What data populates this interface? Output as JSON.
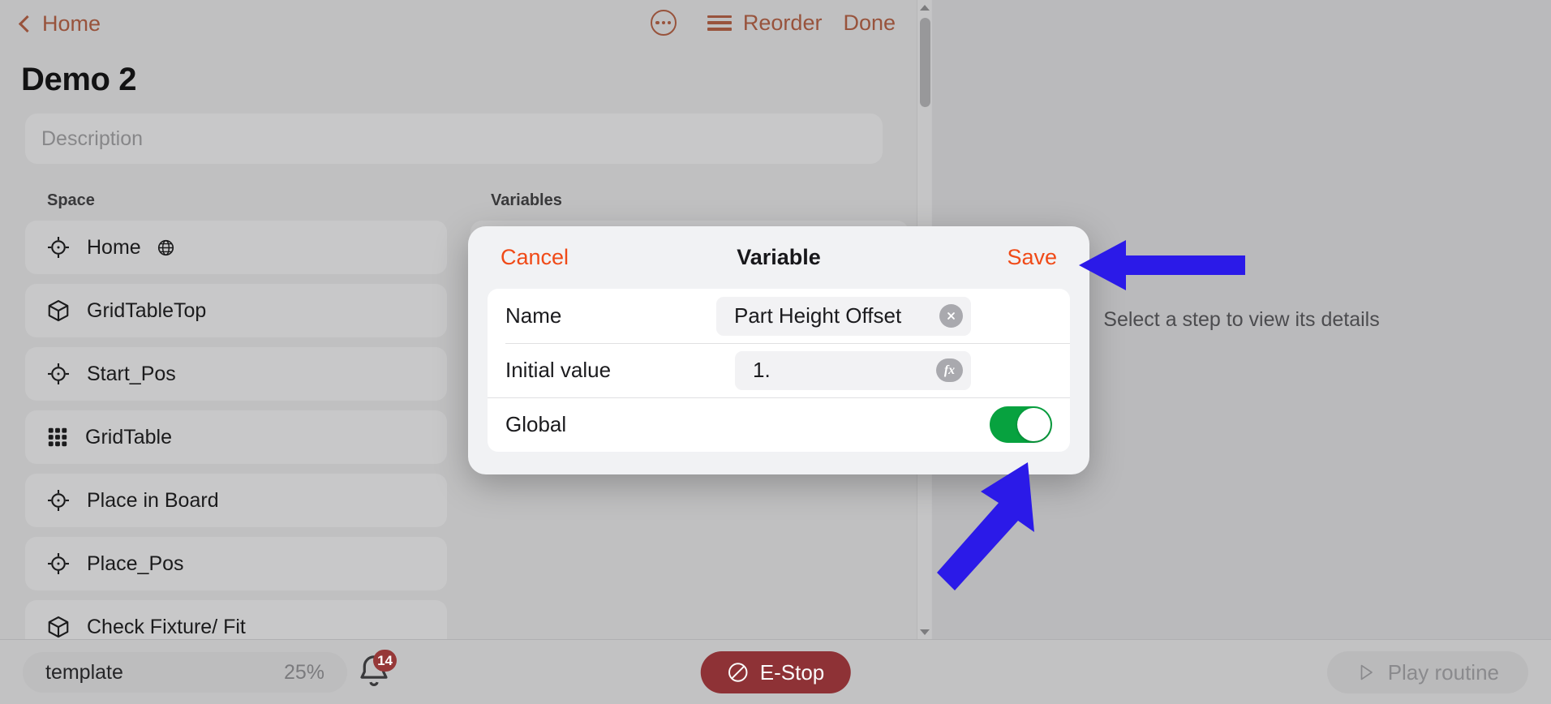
{
  "header": {
    "back_label": "Home",
    "back_icon": "chevron-left-icon",
    "more_icon": "more-circle-icon",
    "reorder_icon": "hamburger-icon",
    "reorder_label": "Reorder",
    "done_label": "Done",
    "accent_color": "#c9491f"
  },
  "routine": {
    "title": "Demo 2",
    "description_placeholder": "Description",
    "description_value": ""
  },
  "columns": {
    "space_label": "Space",
    "variables_label": "Variables"
  },
  "space_items": [
    {
      "label": "Home",
      "icon": "target-icon",
      "badge_icon": "globe-icon"
    },
    {
      "label": "GridTableTop",
      "icon": "cube-icon",
      "badge_icon": ""
    },
    {
      "label": "Start_Pos",
      "icon": "target-icon",
      "badge_icon": ""
    },
    {
      "label": "GridTable",
      "icon": "grid-icon",
      "badge_icon": ""
    },
    {
      "label": "Place in Board",
      "icon": "target-icon",
      "badge_icon": ""
    },
    {
      "label": "Place_Pos",
      "icon": "target-icon",
      "badge_icon": ""
    },
    {
      "label": "Check Fixture/ Fit",
      "icon": "cube-icon",
      "badge_icon": ""
    }
  ],
  "detail": {
    "empty_message": "Select a step to view its details"
  },
  "modal": {
    "cancel_label": "Cancel",
    "title": "Variable",
    "save_label": "Save",
    "rows": {
      "name_label": "Name",
      "name_value": "Part Height Offset",
      "name_clear_icon": "clear-circle-icon",
      "initial_value_label": "Initial value",
      "initial_value": "1.",
      "initial_value_fx_icon": "fx-icon",
      "fx_label": "fx",
      "global_label": "Global",
      "global_enabled": "on"
    },
    "accent_color": "#f04a17",
    "toggle_on_color": "#07a23f"
  },
  "bottom_bar": {
    "template_name": "template",
    "template_percent": "25%",
    "bell_icon": "bell-icon",
    "notification_count": "14",
    "estop_label": "E-Stop",
    "estop_icon": "no-entry-icon",
    "estop_color": "#cc2229",
    "play_label": "Play routine",
    "play_icon": "play-triangle-icon",
    "play_disabled": "true"
  },
  "scrollbar": {
    "up_icon": "caret-up-icon",
    "down_icon": "caret-down-icon"
  },
  "annotations": {
    "arrow_color": "#2b1ae8",
    "save_arrow": "arrow-pointing-at-save",
    "toggle_arrow": "arrow-pointing-at-global-toggle"
  }
}
